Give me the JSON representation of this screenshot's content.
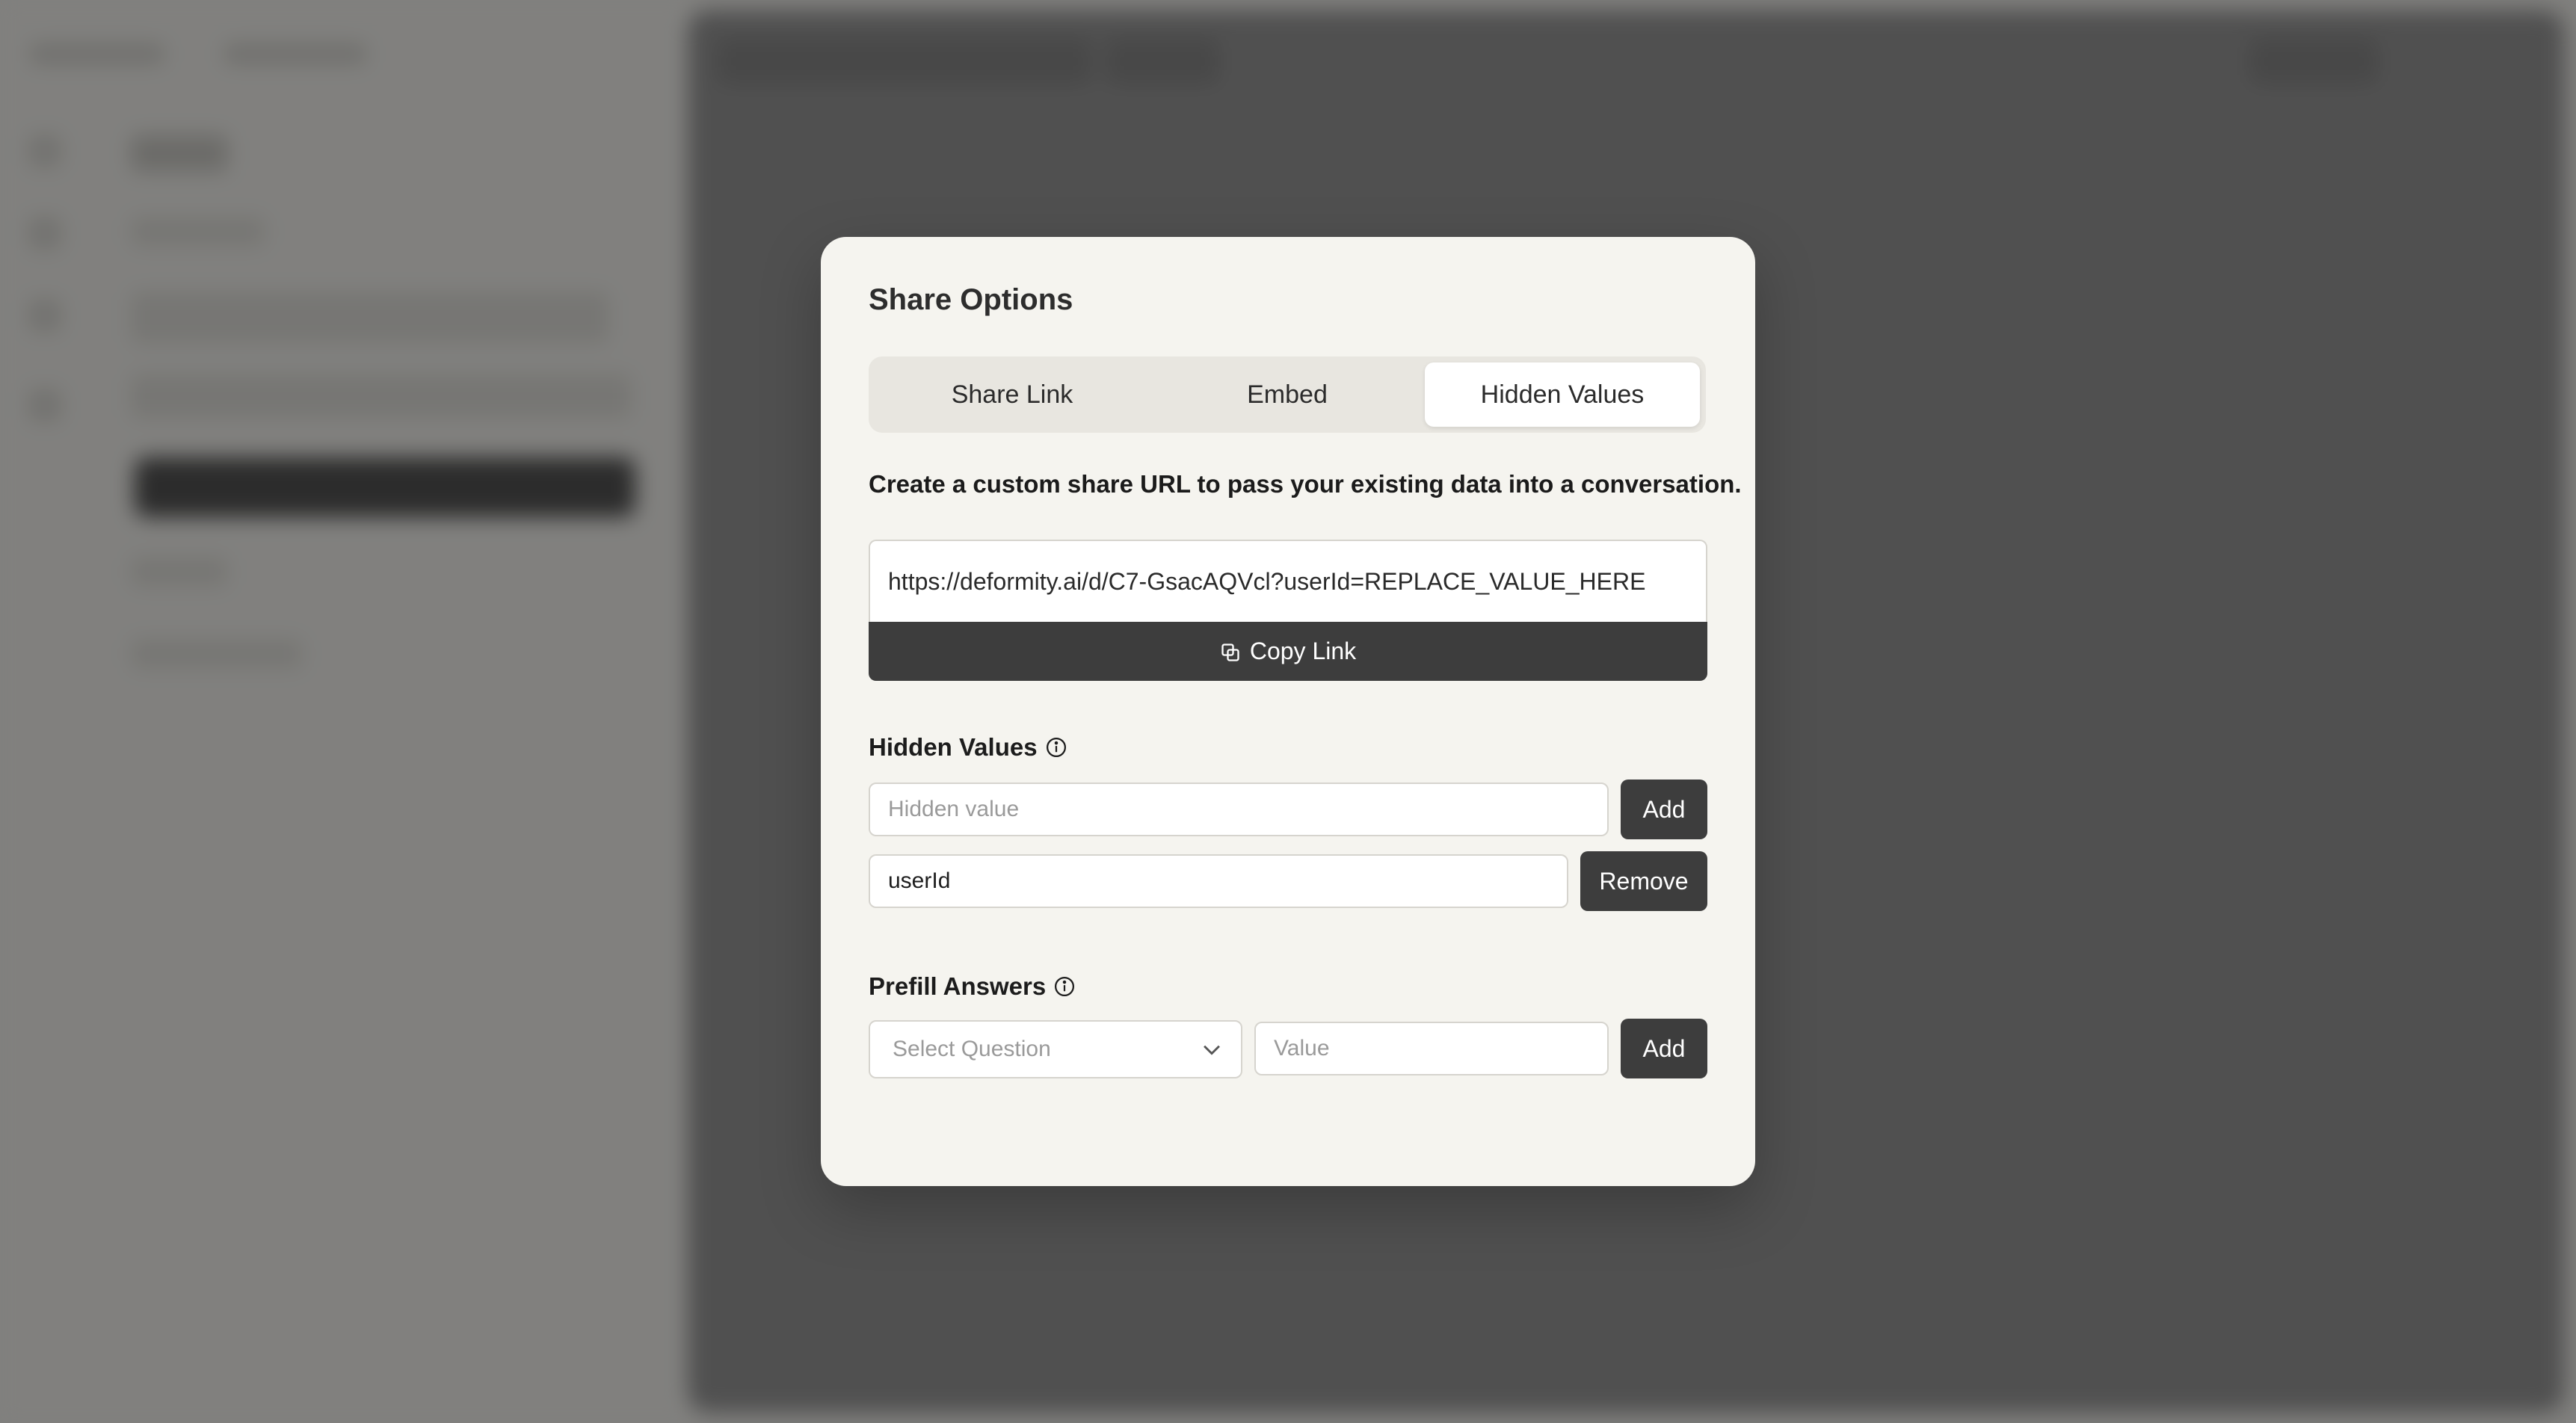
{
  "modal": {
    "title": "Share Options",
    "tabs": [
      {
        "label": "Share Link",
        "active": false
      },
      {
        "label": "Embed",
        "active": false
      },
      {
        "label": "Hidden Values",
        "active": true
      }
    ],
    "description": "Create a custom share URL to pass your existing data into a conversation.",
    "share_url": "https://deformity.ai/d/C7-GsacAQVcl?userId=REPLACE_VALUE_HERE",
    "copy_link_label": "Copy Link",
    "hidden_values": {
      "label": "Hidden Values",
      "input_placeholder": "Hidden value",
      "add_label": "Add",
      "items": [
        {
          "value": "userId",
          "remove_label": "Remove"
        }
      ]
    },
    "prefill_answers": {
      "label": "Prefill Answers",
      "select_placeholder": "Select Question",
      "value_placeholder": "Value",
      "add_label": "Add"
    }
  },
  "colors": {
    "modal_bg": "#f5f4ef",
    "button_dark": "#3d3d3d",
    "overlay": "rgba(0,0,0,0.48)"
  },
  "icons": {
    "copy": "copy-icon",
    "info": "info-icon",
    "chevron": "chevron-down-icon"
  }
}
